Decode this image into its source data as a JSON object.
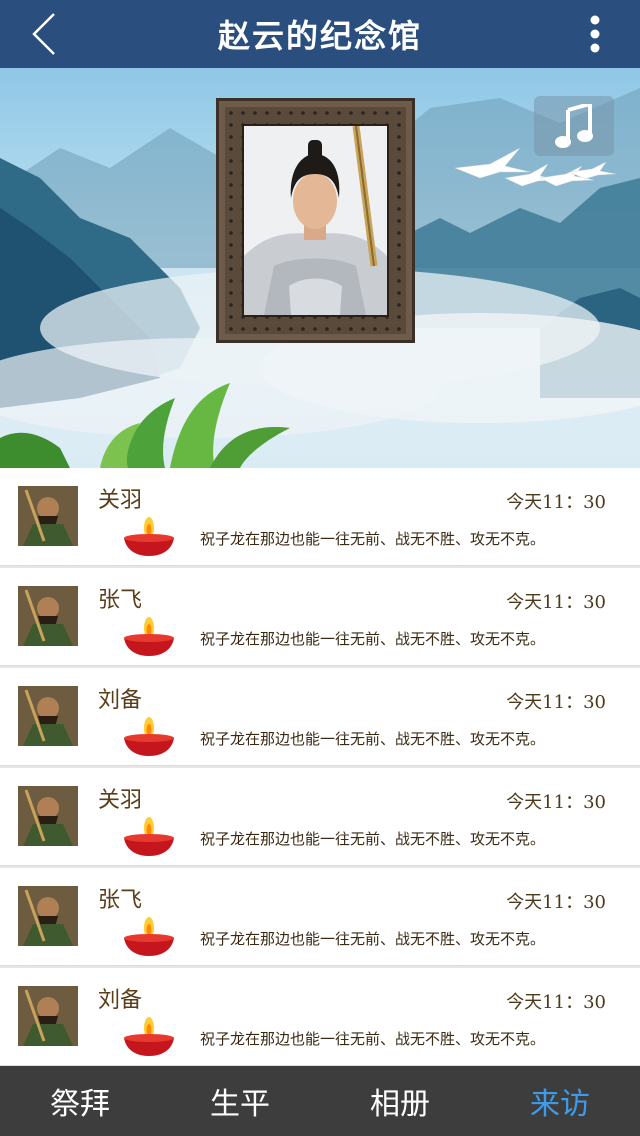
{
  "header": {
    "title": "赵云的纪念馆",
    "back_icon": "chevron-left-icon",
    "more_icon": "more-vertical-icon"
  },
  "banner": {
    "music_icon": "music-note-icon"
  },
  "visits": [
    {
      "name": "关羽",
      "time": "今天11：30",
      "message": "祝子龙在那边也能一往无前、战无不胜、攻无不克。"
    },
    {
      "name": "张飞",
      "time": "今天11：30",
      "message": "祝子龙在那边也能一往无前、战无不胜、攻无不克。"
    },
    {
      "name": "刘备",
      "time": "今天11：30",
      "message": "祝子龙在那边也能一往无前、战无不胜、攻无不克。"
    },
    {
      "name": "关羽",
      "time": "今天11：30",
      "message": "祝子龙在那边也能一往无前、战无不胜、攻无不克。"
    },
    {
      "name": "张飞",
      "time": "今天11：30",
      "message": "祝子龙在那边也能一往无前、战无不胜、攻无不克。"
    },
    {
      "name": "刘备",
      "time": "今天11：30",
      "message": "祝子龙在那边也能一往无前、战无不胜、攻无不克。"
    }
  ],
  "tabs": [
    {
      "label": "祭拜",
      "active": false
    },
    {
      "label": "生平",
      "active": false
    },
    {
      "label": "相册",
      "active": false
    },
    {
      "label": "来访",
      "active": true
    }
  ],
  "colors": {
    "header_bg": "#2a4e7d",
    "tabbar_bg": "#3d3d3d",
    "active_tab": "#3f9be8"
  }
}
